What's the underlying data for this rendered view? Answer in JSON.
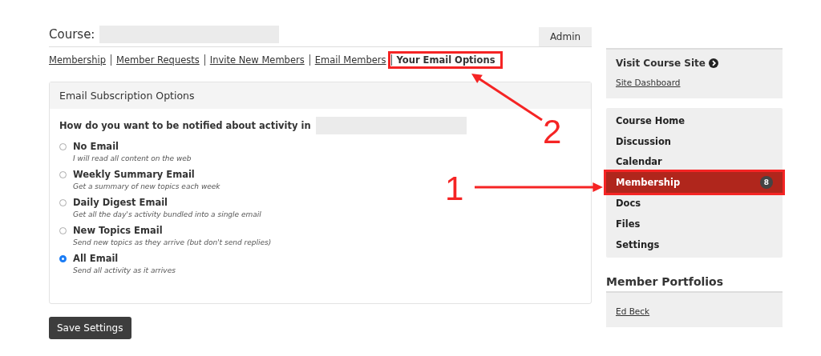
{
  "course": {
    "label": "Course:",
    "role_button": "Admin"
  },
  "tabs": [
    {
      "label": "Membership",
      "selected": false,
      "highlighted": false
    },
    {
      "label": "Member Requests",
      "selected": false,
      "highlighted": false
    },
    {
      "label": "Invite New Members",
      "selected": false,
      "highlighted": false
    },
    {
      "label": "Email Members",
      "selected": false,
      "highlighted": false
    },
    {
      "label": "Your Email Options",
      "selected": true,
      "highlighted": true
    }
  ],
  "panel": {
    "title": "Email Subscription Options",
    "question": "How do you want to be notified about activity in",
    "options": [
      {
        "label": "No Email",
        "description": "I will read all content on the web",
        "selected": false
      },
      {
        "label": "Weekly Summary Email",
        "description": "Get a summary of new topics each week",
        "selected": false
      },
      {
        "label": "Daily Digest Email",
        "description": "Get all the day's activity bundled into a single email",
        "selected": false
      },
      {
        "label": "New Topics Email",
        "description": "Send new topics as they arrive (but don't send replies)",
        "selected": false
      },
      {
        "label": "All Email",
        "description": "Send all activity as it arrives",
        "selected": true
      }
    ]
  },
  "save_button": "Save Settings",
  "sidebar": {
    "visit_link": "Visit Course Site",
    "dashboard_link": "Site Dashboard",
    "nav": [
      {
        "label": "Course Home",
        "selected": false,
        "highlighted": false
      },
      {
        "label": "Discussion",
        "selected": false,
        "highlighted": false
      },
      {
        "label": "Calendar",
        "selected": false,
        "highlighted": false
      },
      {
        "label": "Membership",
        "selected": true,
        "highlighted": true,
        "badge": "8"
      },
      {
        "label": "Docs",
        "selected": false,
        "highlighted": false
      },
      {
        "label": "Files",
        "selected": false,
        "highlighted": false
      },
      {
        "label": "Settings",
        "selected": false,
        "highlighted": false
      }
    ],
    "portfolios_title": "Member Portfolios",
    "portfolios": [
      "Ed Beck"
    ]
  },
  "callouts": [
    {
      "number": "1"
    },
    {
      "number": "2"
    }
  ]
}
